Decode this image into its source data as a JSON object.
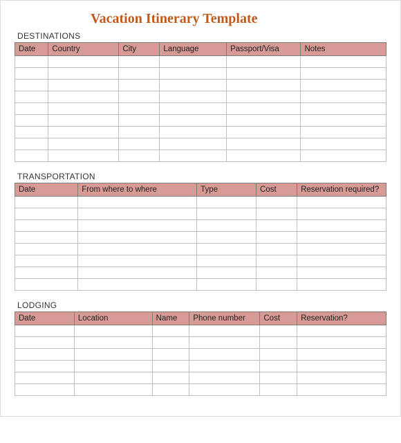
{
  "title": "Vacation Itinerary Template",
  "sections": {
    "destinations": {
      "label": "DESTINATIONS",
      "headers": [
        "Date",
        "Country",
        "City",
        "Language",
        "Passport/Visa",
        "Notes"
      ],
      "row_count": 9
    },
    "transportation": {
      "label": "TRANSPORTATION",
      "headers": [
        "Date",
        "From where to where",
        "Type",
        "Cost",
        "Reservation required?"
      ],
      "row_count": 8
    },
    "lodging": {
      "label": "LODGING",
      "headers": [
        "Date",
        "Location",
        "Name",
        "Phone number",
        "Cost",
        "Reservation?"
      ],
      "row_count": 6
    }
  }
}
